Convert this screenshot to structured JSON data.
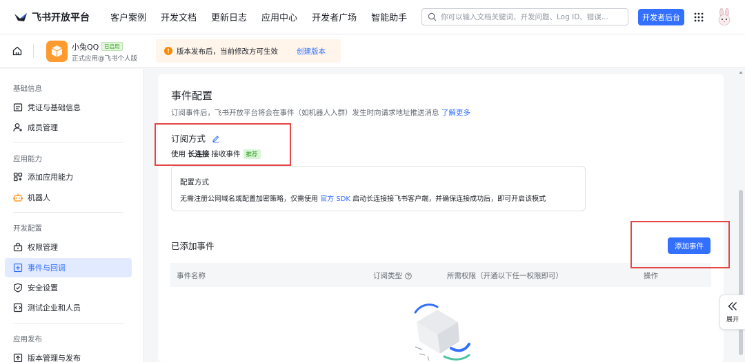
{
  "topnav": {
    "logo_text": "飞书开放平台",
    "items": [
      "客户案例",
      "开发文档",
      "更新日志",
      "应用中心",
      "开发者广场",
      "智能助手"
    ],
    "search_placeholder": "你可以输入文档关键词、开发问题、Log ID、错误...",
    "console_button": "开发者后台"
  },
  "appbar": {
    "app_name": "小兔QQ",
    "app_status": "已启用",
    "app_sub": "正式应用@飞书个人版",
    "notice_text": "版本发布后，当前修改方可生效",
    "notice_link": "创建版本"
  },
  "sidebar": {
    "groups": [
      "基础信息",
      "应用能力",
      "开发配置",
      "应用发布"
    ],
    "items": [
      {
        "label": "凭证与基础信息",
        "icon": "credential-icon"
      },
      {
        "label": "成员管理",
        "icon": "member-icon"
      },
      {
        "label": "添加应用能力",
        "icon": "add-capability-icon"
      },
      {
        "label": "机器人",
        "icon": "robot-icon"
      },
      {
        "label": "权限管理",
        "icon": "permission-icon"
      },
      {
        "label": "事件与回调",
        "icon": "event-icon",
        "active": true
      },
      {
        "label": "安全设置",
        "icon": "shield-icon"
      },
      {
        "label": "测试企业和人员",
        "icon": "test-icon"
      },
      {
        "label": "版本管理与发布",
        "icon": "version-icon"
      }
    ]
  },
  "main": {
    "title": "事件配置",
    "desc": "订阅事件后，飞书开放平台将会在事件（如机器人入群）发生时向请求地址推送消息",
    "desc_link": "了解更多",
    "sub_title": "订阅方式",
    "sub_line_prefix": "使用",
    "sub_line_bold": "长连接",
    "sub_line_suffix": "接收事件",
    "sub_tag": "推荐",
    "config_title": "配置方式",
    "config_desc_prefix": "无需注册公网域名或配置加密策略，仅需使用",
    "config_desc_link": "官方 SDK",
    "config_desc_suffix": "启动长连接接飞书客户端，并确保连接成功后，即可开启该模式",
    "added_title": "已添加事件",
    "add_button": "添加事件",
    "table_headers": [
      "事件名称",
      "订阅类型",
      "所需权限（开通以下任一权限即可）",
      "操作"
    ]
  },
  "expand": {
    "label": "展开"
  },
  "colors": {
    "primary": "#3370ff",
    "highlight": "#e54545",
    "app_icon": "#ff9a2e"
  }
}
